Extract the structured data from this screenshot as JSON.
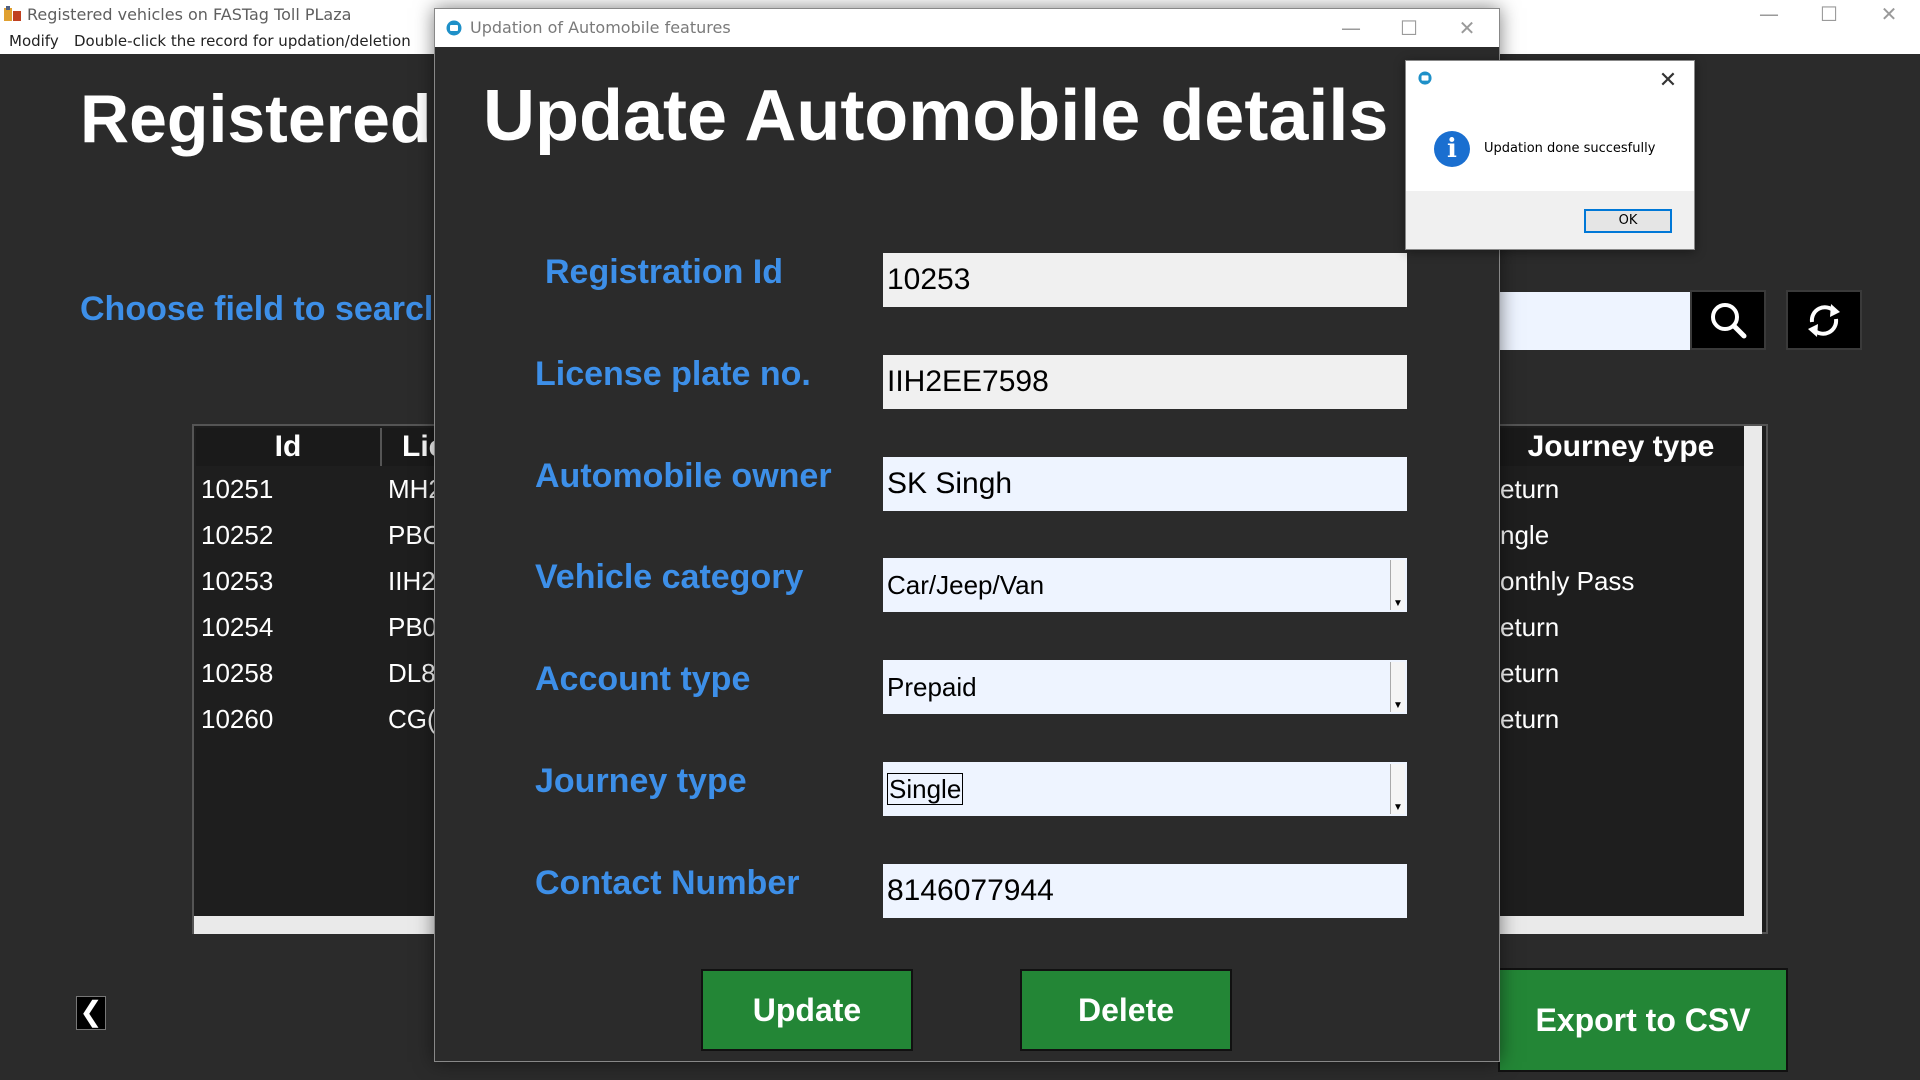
{
  "main_window": {
    "title": "Registered vehicles on FASTag Toll PLaza",
    "menu": {
      "modify": "Modify",
      "hint": "Double-click the record for updation/deletion"
    },
    "controls": {
      "minimize": "—",
      "maximize": "☐",
      "close": "✕"
    },
    "heading": "Registered",
    "search_label": "Choose field to searcl",
    "table": {
      "headers": {
        "id": "Id",
        "license": "Lic",
        "journey": "Journey type"
      },
      "rows": [
        {
          "id": "10251",
          "license": "MH2",
          "journey": "eturn"
        },
        {
          "id": "10252",
          "license": "PBC",
          "journey": "ngle"
        },
        {
          "id": "10253",
          "license": "IIH2",
          "journey": "onthly Pass"
        },
        {
          "id": "10254",
          "license": "PB0",
          "journey": "eturn"
        },
        {
          "id": "10258",
          "license": "DL8",
          "journey": "eturn"
        },
        {
          "id": "10260",
          "license": "CG(",
          "journey": "eturn"
        }
      ]
    },
    "back_glyph": "❮",
    "export_label": "Export to CSV"
  },
  "dialog": {
    "title": "Updation of Automobile features",
    "controls": {
      "minimize": "—",
      "maximize": "☐",
      "close": "✕"
    },
    "heading": "Update Automobile details",
    "fields": {
      "registration_id": {
        "label": "Registration Id",
        "value": "10253"
      },
      "license_plate": {
        "label": "License plate no.",
        "value": "IIH2EE7598"
      },
      "owner": {
        "label": "Automobile owner",
        "value": "SK Singh"
      },
      "vehicle_category": {
        "label": "Vehicle category",
        "value": "Car/Jeep/Van"
      },
      "account_type": {
        "label": "Account type",
        "value": "Prepaid"
      },
      "journey_type": {
        "label": "Journey type",
        "value": "Single"
      },
      "contact": {
        "label": "Contact Number",
        "value": "8146077944"
      }
    },
    "update_label": "Update",
    "delete_label": "Delete"
  },
  "message_box": {
    "text": "Updation done succesfully",
    "ok_label": "OK",
    "close": "✕",
    "info_glyph": "i"
  },
  "colors": {
    "background": "#2b2b2b",
    "label_blue": "#3d8fe8",
    "button_green": "#238636",
    "input_bg": "#eef4ff"
  }
}
